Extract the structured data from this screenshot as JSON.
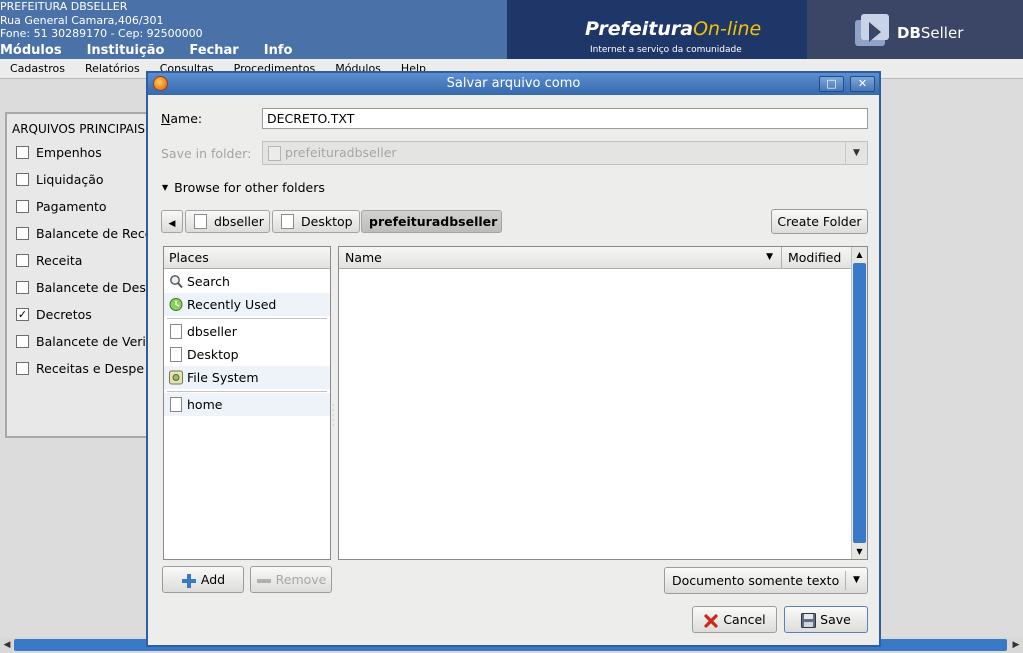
{
  "app": {
    "org_name": "PREFEITURA DBSELLER",
    "address": "Rua General Camara,406/301",
    "contact": "Fone: 51 30289170  -  Cep: 92500000",
    "banner": {
      "title_main": "Prefeitura",
      "title_accent": "On-line",
      "subtitle": "Internet a serviço da comunidade"
    },
    "logo": {
      "bold": "DB",
      "rest": "Seller",
      "icon": "dbseller-logo-icon"
    },
    "main_menu": [
      "Módulos",
      "Instituição",
      "Fechar",
      "Info"
    ],
    "sub_menu": [
      "Cadastros",
      "Relatórios",
      "Consultas",
      "Procedimentos",
      "Módulos",
      "Help"
    ],
    "files_panel": {
      "title": "ARQUIVOS PRINCIPAIS",
      "items": [
        {
          "label": "Empenhos",
          "checked": false
        },
        {
          "label": "Liquidação",
          "checked": false
        },
        {
          "label": "Pagamento",
          "checked": false
        },
        {
          "label": "Balancete de Rece",
          "checked": false
        },
        {
          "label": "Receita",
          "checked": false
        },
        {
          "label": "Balancete de Des",
          "checked": false
        },
        {
          "label": "Decretos",
          "checked": true
        },
        {
          "label": "Balancete de Veri",
          "checked": false
        },
        {
          "label": "Receitas e Despe",
          "checked": false
        }
      ]
    },
    "check_mark": "✓"
  },
  "dialog": {
    "title": "Salvar arquivo como",
    "name_label": "Name:",
    "name_value": "DECRETO.TXT",
    "save_in_label": "Save in folder:",
    "save_in_value": "prefeituradbseller",
    "browse_label": "Browse for other folders",
    "path": [
      "dbseller",
      "Desktop",
      "prefeituradbseller"
    ],
    "create_folder_label": "Create Folder",
    "places_header": "Places",
    "places": [
      {
        "label": "Search",
        "icon": "magnifier-icon"
      },
      {
        "label": "Recently Used",
        "icon": "clock-icon"
      },
      {
        "label": "dbseller",
        "icon": "folder-icon"
      },
      {
        "label": "Desktop",
        "icon": "folder-icon"
      },
      {
        "label": "File System",
        "icon": "drive-icon"
      },
      {
        "label": "home",
        "icon": "folder-icon"
      }
    ],
    "columns": {
      "name": "Name",
      "modified": "Modified"
    },
    "add_label": "Add",
    "remove_label": "Remove",
    "filter_value": "Documento somente texto",
    "cancel_label": "Cancel",
    "save_label": "Save"
  },
  "colors": {
    "header_blue": "#4a72a8",
    "titlebar_blue": "#3569ad",
    "scroll_blue": "#3a78c8"
  }
}
